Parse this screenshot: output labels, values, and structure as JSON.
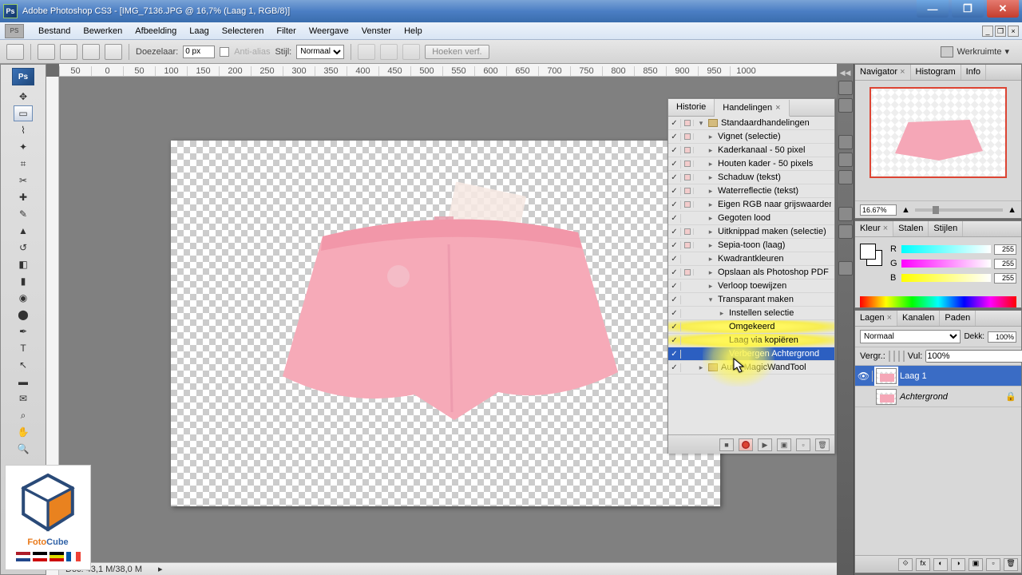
{
  "title": "Adobe Photoshop CS3 - [IMG_7136.JPG @ 16,7% (Laag 1, RGB/8)]",
  "menu": [
    "Bestand",
    "Bewerken",
    "Afbeelding",
    "Laag",
    "Selecteren",
    "Filter",
    "Weergave",
    "Venster",
    "Help"
  ],
  "options": {
    "doezelaar_label": "Doezelaar:",
    "doezelaar_value": "0 px",
    "antialias_label": "Anti-alias",
    "stijl_label": "Stijl:",
    "stijl_value": "Normaal",
    "refine": "Hoeken verf.",
    "workspace": "Werkruimte"
  },
  "ruler_marks": [
    "50",
    "0",
    "50",
    "100",
    "150",
    "200",
    "250",
    "300",
    "350",
    "400",
    "450",
    "500",
    "550",
    "600",
    "650",
    "700",
    "750",
    "800",
    "850",
    "900",
    "950",
    "1000"
  ],
  "actions_panel": {
    "tabs": [
      "Historie",
      "Handelingen"
    ],
    "active_tab": 1,
    "set": "Standaardhandelingen",
    "items": [
      {
        "label": "Vignet (selectie)",
        "checked": true,
        "dialog": true
      },
      {
        "label": "Kaderkanaal - 50 pixel",
        "checked": true,
        "dialog": true
      },
      {
        "label": "Houten kader - 50 pixels",
        "checked": true,
        "dialog": true
      },
      {
        "label": "Schaduw (tekst)",
        "checked": true,
        "dialog": true
      },
      {
        "label": "Waterreflectie (tekst)",
        "checked": true,
        "dialog": true
      },
      {
        "label": "Eigen RGB naar grijswaarden",
        "checked": true,
        "dialog": true
      },
      {
        "label": "Gegoten lood",
        "checked": true,
        "dialog": true
      },
      {
        "label": "Uitknippad maken (selectie)",
        "checked": true,
        "dialog": true
      },
      {
        "label": "Sepia-toon (laag)",
        "checked": true,
        "dialog": true
      },
      {
        "label": "Kwadrantkleuren",
        "checked": true,
        "dialog": true
      },
      {
        "label": "Opslaan als Photoshop PDF",
        "checked": true,
        "dialog": true
      },
      {
        "label": "Verloop toewijzen",
        "checked": true,
        "dialog": true
      }
    ],
    "expanded": {
      "label": "Transparant maken",
      "steps": [
        {
          "label": "Instellen selectie",
          "arrow": true
        },
        {
          "label": "Omgekeerd"
        },
        {
          "label": "Laag via kopiëren"
        },
        {
          "label": "Verbergen Achtergrond",
          "selected": true
        }
      ]
    },
    "last": "Auto_MagicWandTool"
  },
  "navigator": {
    "tabs": [
      "Navigator",
      "Histogram",
      "Info"
    ],
    "zoom": "16.67%"
  },
  "color": {
    "tabs": [
      "Kleur",
      "Stalen",
      "Stijlen"
    ],
    "r_label": "R",
    "g_label": "G",
    "b_label": "B",
    "r": "255",
    "g": "255",
    "b": "255"
  },
  "layers": {
    "tabs": [
      "Lagen",
      "Kanalen",
      "Paden"
    ],
    "blend": "Normaal",
    "opacity_label": "Dekk:",
    "opacity": "100%",
    "lock_label": "Vergr.:",
    "fill_label": "Vul:",
    "fill": "100%",
    "items": [
      {
        "name": "Laag 1",
        "visible": true,
        "selected": true
      },
      {
        "name": "Achtergrond",
        "visible": false,
        "locked": true
      }
    ]
  },
  "status": {
    "doc": "Doc: 43,1 M/38,0 M"
  },
  "fotocube": {
    "brand_a": "Foto",
    "brand_b": "Cube"
  }
}
